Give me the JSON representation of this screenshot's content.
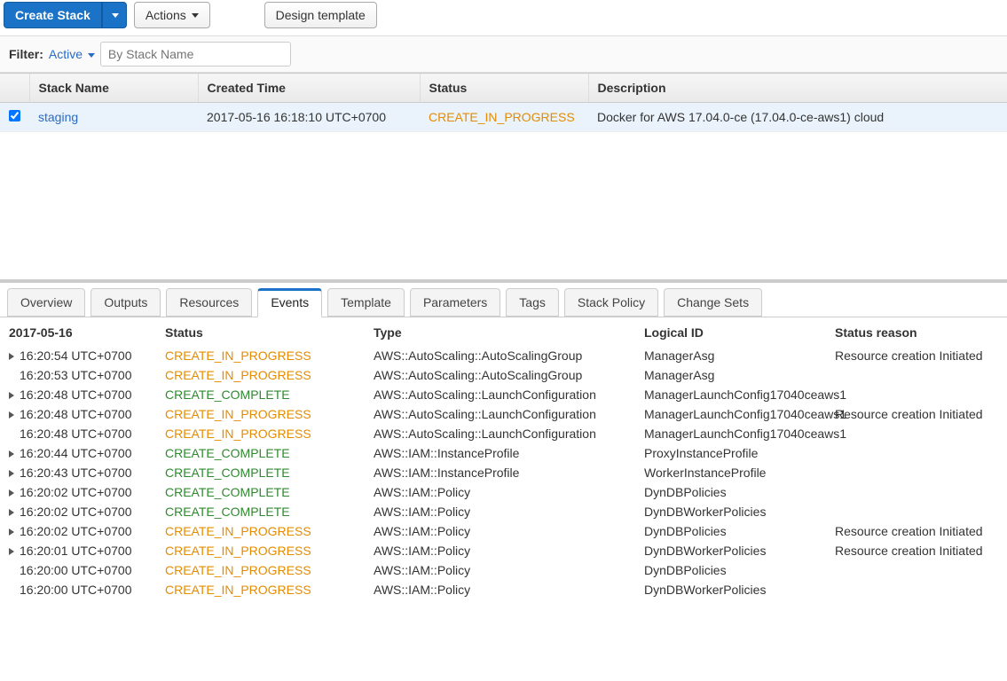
{
  "toolbar": {
    "create_stack_label": "Create Stack",
    "actions_label": "Actions",
    "design_template_label": "Design template"
  },
  "filter": {
    "label": "Filter:",
    "active_label": "Active",
    "placeholder": "By Stack Name"
  },
  "stack_table": {
    "headers": {
      "name": "Stack Name",
      "created": "Created Time",
      "status": "Status",
      "description": "Description"
    },
    "rows": [
      {
        "checked": true,
        "name": "staging",
        "created": "2017-05-16 16:18:10 UTC+0700",
        "status": "CREATE_IN_PROGRESS",
        "description": "Docker for AWS 17.04.0-ce (17.04.0-ce-aws1) cloud"
      }
    ]
  },
  "tabs": [
    "Overview",
    "Outputs",
    "Resources",
    "Events",
    "Template",
    "Parameters",
    "Tags",
    "Stack Policy",
    "Change Sets"
  ],
  "active_tab": "Events",
  "events": {
    "date": "2017-05-16",
    "headers": {
      "status": "Status",
      "type": "Type",
      "logical_id": "Logical ID",
      "reason": "Status reason"
    },
    "rows": [
      {
        "expand": true,
        "time": "16:20:54 UTC+0700",
        "status": "CREATE_IN_PROGRESS",
        "style": "orange",
        "type": "AWS::AutoScaling::AutoScalingGroup",
        "logical_id": "ManagerAsg",
        "reason": "Resource creation Initiated"
      },
      {
        "expand": false,
        "time": "16:20:53 UTC+0700",
        "status": "CREATE_IN_PROGRESS",
        "style": "orange",
        "type": "AWS::AutoScaling::AutoScalingGroup",
        "logical_id": "ManagerAsg",
        "reason": ""
      },
      {
        "expand": true,
        "time": "16:20:48 UTC+0700",
        "status": "CREATE_COMPLETE",
        "style": "green",
        "type": "AWS::AutoScaling::LaunchConfiguration",
        "logical_id": "ManagerLaunchConfig17040ceaws1",
        "reason": ""
      },
      {
        "expand": true,
        "time": "16:20:48 UTC+0700",
        "status": "CREATE_IN_PROGRESS",
        "style": "orange",
        "type": "AWS::AutoScaling::LaunchConfiguration",
        "logical_id": "ManagerLaunchConfig17040ceaws1",
        "reason": "Resource creation Initiated"
      },
      {
        "expand": false,
        "time": "16:20:48 UTC+0700",
        "status": "CREATE_IN_PROGRESS",
        "style": "orange",
        "type": "AWS::AutoScaling::LaunchConfiguration",
        "logical_id": "ManagerLaunchConfig17040ceaws1",
        "reason": ""
      },
      {
        "expand": true,
        "time": "16:20:44 UTC+0700",
        "status": "CREATE_COMPLETE",
        "style": "green",
        "type": "AWS::IAM::InstanceProfile",
        "logical_id": "ProxyInstanceProfile",
        "reason": ""
      },
      {
        "expand": true,
        "time": "16:20:43 UTC+0700",
        "status": "CREATE_COMPLETE",
        "style": "green",
        "type": "AWS::IAM::InstanceProfile",
        "logical_id": "WorkerInstanceProfile",
        "reason": ""
      },
      {
        "expand": true,
        "time": "16:20:02 UTC+0700",
        "status": "CREATE_COMPLETE",
        "style": "green",
        "type": "AWS::IAM::Policy",
        "logical_id": "DynDBPolicies",
        "reason": ""
      },
      {
        "expand": true,
        "time": "16:20:02 UTC+0700",
        "status": "CREATE_COMPLETE",
        "style": "green",
        "type": "AWS::IAM::Policy",
        "logical_id": "DynDBWorkerPolicies",
        "reason": ""
      },
      {
        "expand": true,
        "time": "16:20:02 UTC+0700",
        "status": "CREATE_IN_PROGRESS",
        "style": "orange",
        "type": "AWS::IAM::Policy",
        "logical_id": "DynDBPolicies",
        "reason": "Resource creation Initiated"
      },
      {
        "expand": true,
        "time": "16:20:01 UTC+0700",
        "status": "CREATE_IN_PROGRESS",
        "style": "orange",
        "type": "AWS::IAM::Policy",
        "logical_id": "DynDBWorkerPolicies",
        "reason": "Resource creation Initiated"
      },
      {
        "expand": false,
        "time": "16:20:00 UTC+0700",
        "status": "CREATE_IN_PROGRESS",
        "style": "orange",
        "type": "AWS::IAM::Policy",
        "logical_id": "DynDBPolicies",
        "reason": ""
      },
      {
        "expand": false,
        "time": "16:20:00 UTC+0700",
        "status": "CREATE_IN_PROGRESS",
        "style": "orange",
        "type": "AWS::IAM::Policy",
        "logical_id": "DynDBWorkerPolicies",
        "reason": ""
      }
    ]
  }
}
